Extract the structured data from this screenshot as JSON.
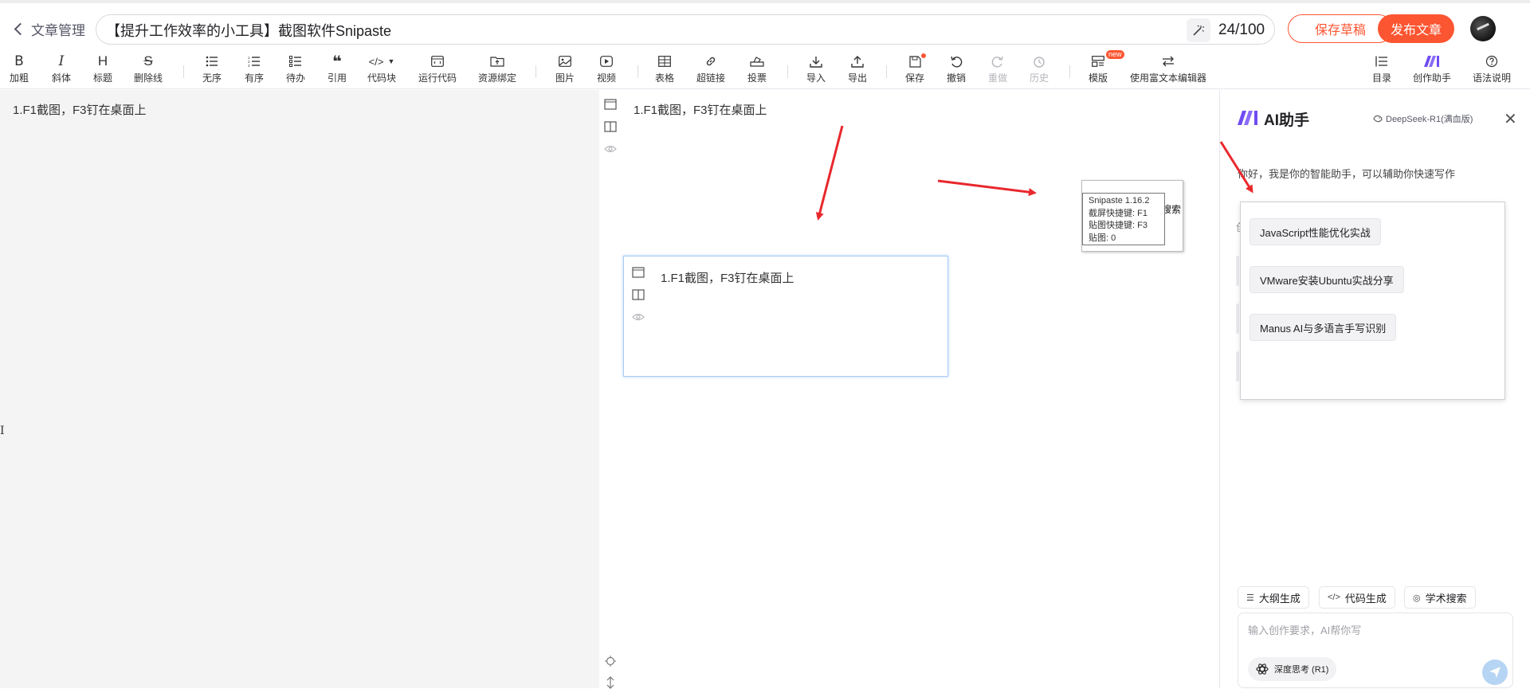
{
  "header": {
    "back_label": "文章管理",
    "title_value": "【提升工作效率的小工具】截图软件Snipaste",
    "title_count": "24/100",
    "save_draft_label": "保存草稿",
    "publish_label": "发布文章",
    "accent_color": "#fc5531"
  },
  "toolbar": {
    "bold": "加粗",
    "italic": "斜体",
    "heading": "标题",
    "strike": "删除线",
    "unordered": "无序",
    "ordered": "有序",
    "todo": "待办",
    "quote": "引用",
    "codeblock": "代码块",
    "run_code": "运行代码",
    "resource_bind": "资源绑定",
    "image": "图片",
    "video": "视频",
    "table": "表格",
    "hyperlink": "超链接",
    "vote": "投票",
    "import": "导入",
    "export": "导出",
    "save": "保存",
    "undo": "撤销",
    "redo": "重做",
    "history": "历史",
    "template": "模版",
    "new_badge": "new",
    "rich_editor": "使用富文本编辑器",
    "toc": "目录",
    "creation_assistant": "创作助手",
    "syntax_help": "语法说明",
    "icons": {
      "bold": "B",
      "italic": "I",
      "heading": "H",
      "strike": "S",
      "quote": "❝",
      "codeblock": "</>"
    }
  },
  "editor": {
    "markdown_text": "1.F1截图，F3钉在桌面上",
    "preview_text": "1.F1截图，F3钉在桌面上",
    "pinned_text": "1.F1截图，F3钉在桌面上"
  },
  "snipaste_tooltip": {
    "lines": [
      "Snipaste 1.16.2",
      "截屏快捷键: F1",
      "贴图快捷键: F3",
      "贴图: 0"
    ],
    "cut_text": "术搜索"
  },
  "ai": {
    "title": "AI助手",
    "model": "DeepSeek-R1(满血版)",
    "greeting": "你好，我是你的智能助手，可以辅助你快速写作",
    "ghost_char": "创",
    "suggestions": [
      "JavaScript性能优化实战",
      "VMware安装Ubuntu实战分享",
      "Manus AI与多语言手写识别"
    ],
    "chips": [
      "大纲生成",
      "代码生成",
      "学术搜索"
    ],
    "input_placeholder": "输入创作要求，AI帮你写",
    "deep_think": "深度思考 (R1)",
    "brand_color": "#6f4cf2"
  },
  "annotations": {
    "arrow_color": "#e8282d"
  }
}
